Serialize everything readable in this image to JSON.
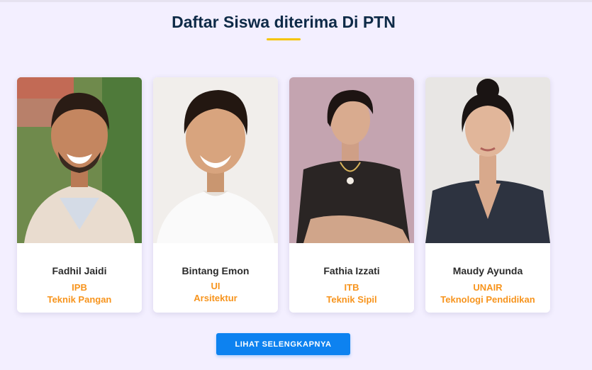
{
  "section": {
    "title": "Daftar Siswa diterima Di PTN"
  },
  "students": [
    {
      "name": "Fadhil Jaidi",
      "university": "IPB",
      "major": "Teknik Pangan"
    },
    {
      "name": "Bintang Emon",
      "university": "UI",
      "major": "Arsitektur"
    },
    {
      "name": "Fathia Izzati",
      "university": "ITB",
      "major": "Teknik Sipil"
    },
    {
      "name": "Maudy Ayunda",
      "university": "UNAIR",
      "major": "Teknologi Pendidikan"
    }
  ],
  "button": {
    "label": "LIHAT SELENGKAPNYA"
  },
  "colors": {
    "page_bg": "#f3efff",
    "title": "#0e2a47",
    "accent_underline": "#f5c400",
    "highlight_text": "#f7941d",
    "button_bg": "#0d82f0"
  }
}
